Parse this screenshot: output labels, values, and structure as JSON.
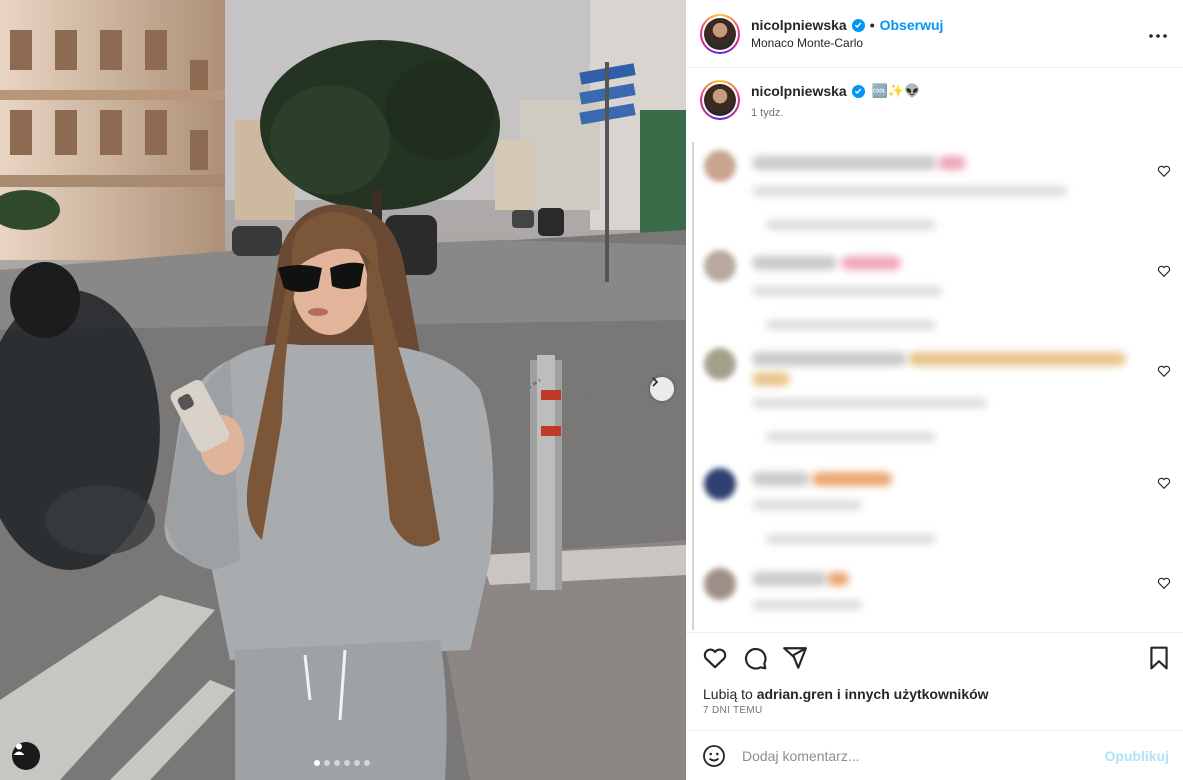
{
  "post": {
    "username": "nicolpniewska",
    "separator": "•",
    "follow_label": "Obserwuj",
    "location": "Monaco Monte-Carlo",
    "caption_time": "1 tydz.",
    "caption_emojis": "🆒✨👽",
    "more_icon": "more-horizontal-icon"
  },
  "carousel": {
    "slide_count": 6,
    "active_slide": 1
  },
  "likes": {
    "prefix": "Lubią to ",
    "user": "adrian.gren",
    "suffix": " i innych użytkowników"
  },
  "date_label": "7 DNI TEMU",
  "comment_box": {
    "placeholder": "Dodaj komentarz...",
    "post_label": "Opublikuj"
  },
  "colors": {
    "accent": "#0095f6",
    "post_disabled": "#b2dffc",
    "text": "#262626",
    "muted": "#737373"
  }
}
